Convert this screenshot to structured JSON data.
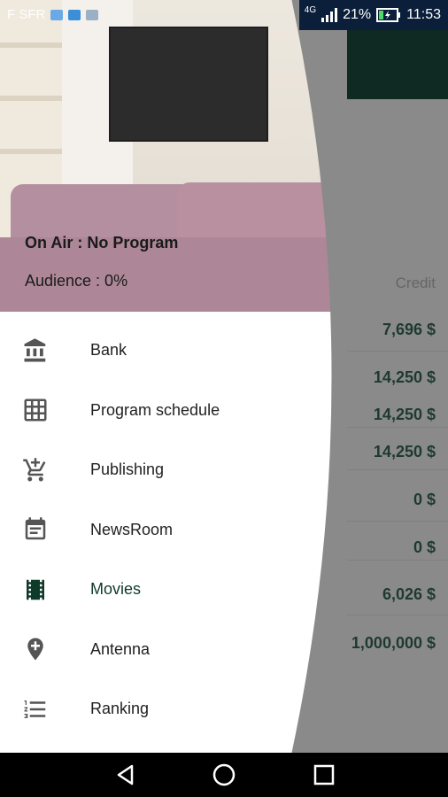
{
  "status_bar": {
    "carrier": "F SFR",
    "network": "4G",
    "battery": "21%",
    "time": "11:53"
  },
  "header": {
    "on_air": "On Air : No Program",
    "audience": "Audience : 0%"
  },
  "menu": {
    "items": [
      {
        "label": "Bank",
        "icon": "bank-icon"
      },
      {
        "label": "Program schedule",
        "icon": "grid-icon"
      },
      {
        "label": "Publishing",
        "icon": "cart-add-icon"
      },
      {
        "label": "NewsRoom",
        "icon": "calendar-icon"
      },
      {
        "label": "Movies",
        "icon": "film-icon"
      },
      {
        "label": "Antenna",
        "icon": "location-pin-icon"
      },
      {
        "label": "Ranking",
        "icon": "list-icon"
      }
    ]
  },
  "background": {
    "credit_header": "Credit",
    "credits": [
      "7,696 $",
      "14,250 $",
      "14,250 $",
      "14,250 $",
      "0 $",
      "0 $",
      "6,026 $",
      "1,000,000 $"
    ]
  },
  "colors": {
    "appbar": "#0e2a22",
    "active_item": "#0e3a2a",
    "status_right": "#0b1f3a"
  }
}
